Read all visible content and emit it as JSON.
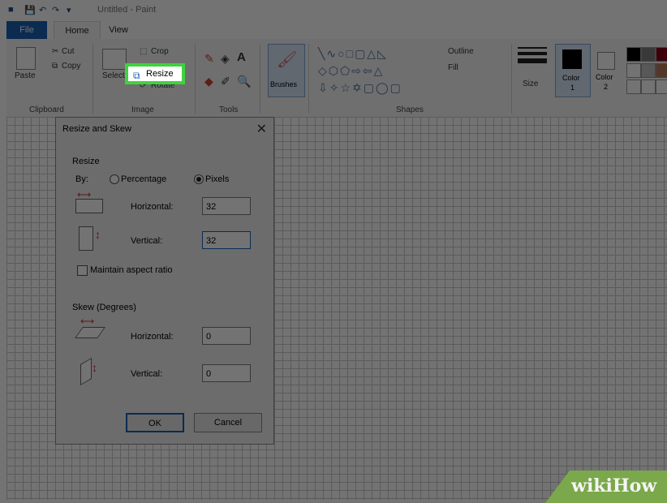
{
  "window": {
    "title": "Untitled - Paint"
  },
  "ribbon_tabs": [
    "File",
    "Home",
    "View"
  ],
  "clipboard": {
    "paste": "Paste",
    "cut": "Cut",
    "copy": "Copy",
    "label": "Clipboard"
  },
  "image_group": {
    "select": "Select",
    "crop": "Crop",
    "resize": "Resize",
    "rotate": "Rotate",
    "label": "Image"
  },
  "tools_group": {
    "label": "Tools"
  },
  "brushes": {
    "label": "Brushes"
  },
  "shapes_group": {
    "outline": "Outline",
    "fill": "Fill",
    "label": "Shapes"
  },
  "size": {
    "label": "Size"
  },
  "colors": {
    "color1": "Color",
    "color1_num": "1",
    "color2": "Color",
    "color2_num": "2",
    "swatches": [
      "#000000",
      "#7f7f7f",
      "#880015",
      "#ffffff",
      "#c3c3c3",
      "#b97a57"
    ]
  },
  "dialog": {
    "title": "Resize and Skew",
    "resize_section": "Resize",
    "by_label": "By:",
    "percentage": "Percentage",
    "pixels": "Pixels",
    "horizontal_label": "Horizontal:",
    "horizontal_value": "32",
    "vertical_label": "Vertical:",
    "vertical_value": "32",
    "maintain_aspect": "Maintain aspect ratio",
    "skew_section": "Skew (Degrees)",
    "skew_horizontal_label": "Horizontal:",
    "skew_horizontal_value": "0",
    "skew_vertical_label": "Vertical:",
    "skew_vertical_value": "0",
    "ok": "OK",
    "cancel": "Cancel"
  },
  "watermark": {
    "brand": "wikiHow"
  }
}
